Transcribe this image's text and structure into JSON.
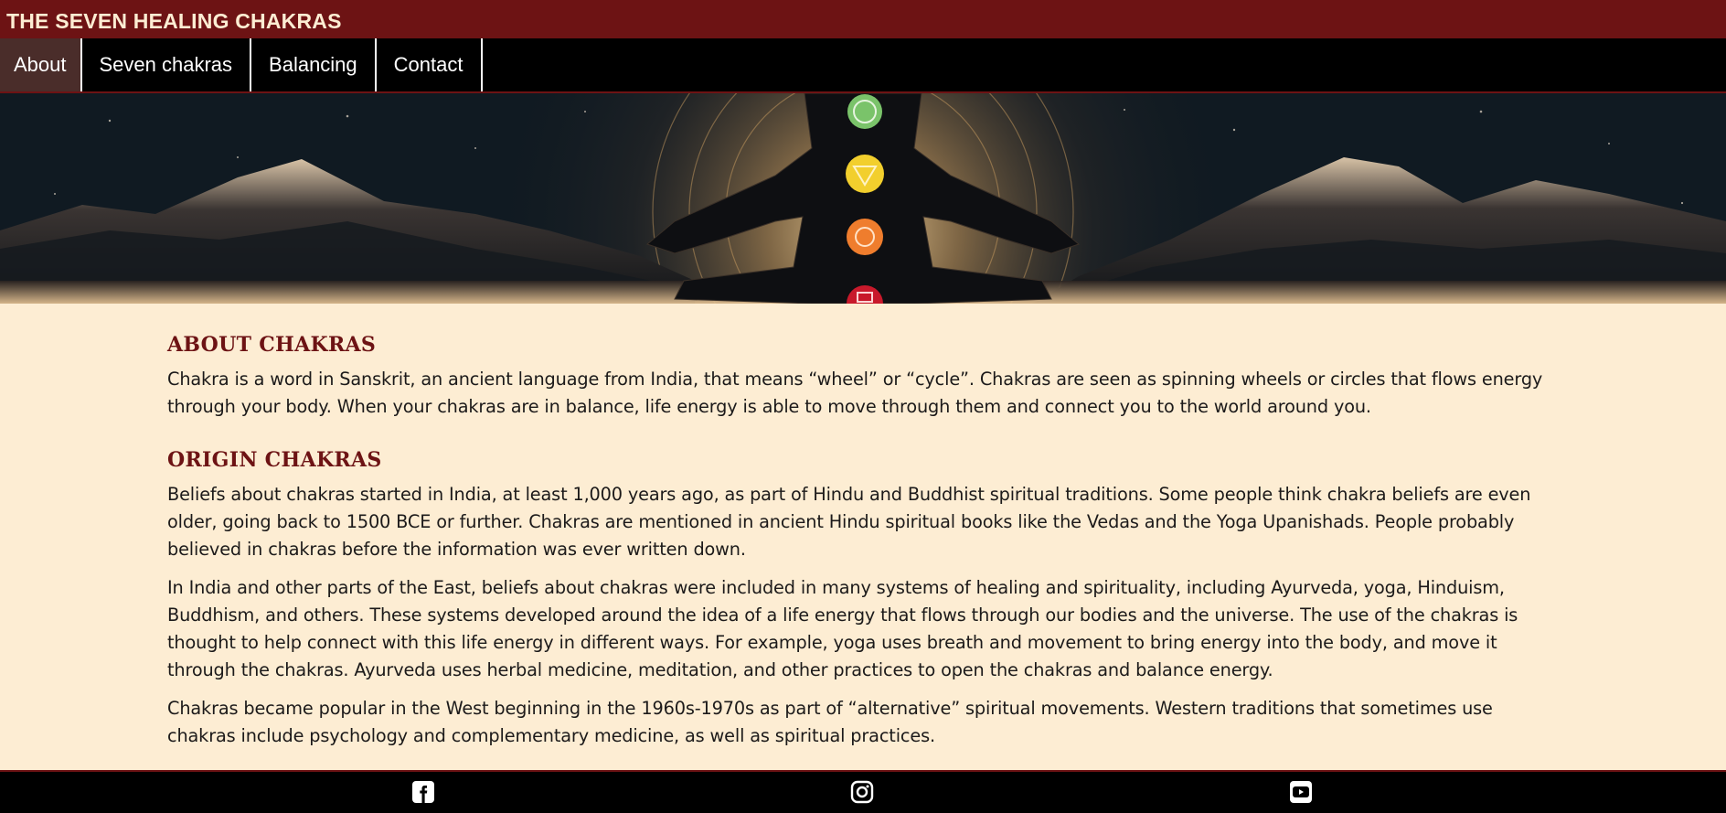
{
  "site": {
    "title": "THE SEVEN HEALING CHAKRAS"
  },
  "nav": {
    "items": [
      {
        "label": "About",
        "active": true
      },
      {
        "label": "Seven chakras",
        "active": false
      },
      {
        "label": "Balancing",
        "active": false
      },
      {
        "label": "Contact",
        "active": false
      }
    ]
  },
  "hero": {
    "image": "meditating-figure-with-chakras-over-mountains",
    "chakra_colors": [
      "#7ac36a",
      "#f2cf2d",
      "#ef7d2d",
      "#c8192b"
    ]
  },
  "content": {
    "sections": [
      {
        "heading": "ABOUT CHAKRAS",
        "paragraphs": [
          "Chakra is a word in Sanskrit, an ancient language from India, that means “wheel” or “cycle”. Chakras are seen as spinning wheels or circles that flows energy through your body. When your chakras are in balance, life energy is able to move through them and connect you to the world around you."
        ]
      },
      {
        "heading": "ORIGIN CHAKRAS",
        "paragraphs": [
          "Beliefs about chakras started in India, at least 1,000 years ago, as part of Hindu and Buddhist spiritual traditions. Some people think chakra beliefs are even older, going back to 1500 BCE or further. Chakras are mentioned in ancient Hindu spiritual books like the Vedas and the Yoga Upanishads. People probably believed in chakras before the information was ever written down.",
          "In India and other parts of the East, beliefs about chakras were included in many systems of healing and spirituality, including Ayurveda, yoga, Hinduism, Buddhism, and others. These systems developed around the idea of a life energy that flows through our bodies and the universe. The use of the chakras is thought to help connect with this life energy in different ways. For example, yoga uses breath and movement to bring energy into the body, and move it through the chakras. Ayurveda uses herbal medicine, meditation, and other practices to open the chakras and balance energy.",
          "Chakras became popular in the West beginning in the 1960s-1970s as part of “alternative” spiritual movements. Western traditions that sometimes use chakras include psychology and complementary medicine, as well as spiritual practices."
        ]
      }
    ]
  },
  "footer": {
    "icons": [
      "facebook-icon",
      "instagram-icon",
      "youtube-icon"
    ]
  },
  "colors": {
    "brand": "#6d1314",
    "background": "#fdedd3",
    "nav_bg": "#000000",
    "nav_active": "#4a2d2a"
  }
}
